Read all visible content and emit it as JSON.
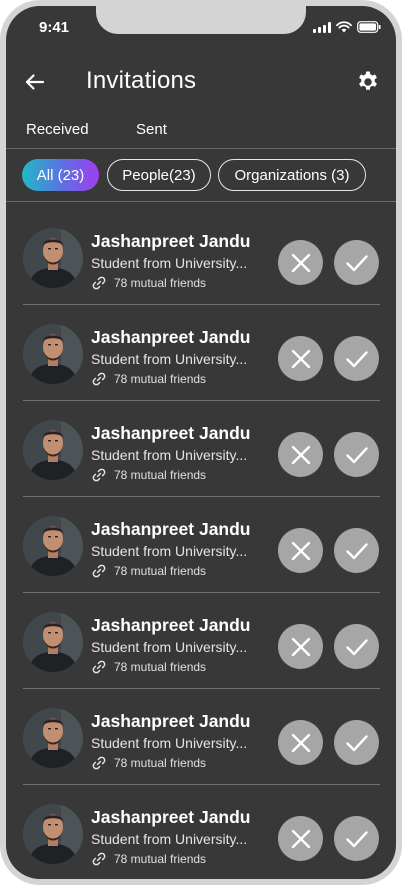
{
  "status_bar": {
    "time": "9:41"
  },
  "header": {
    "title": "Invitations"
  },
  "tabs": [
    {
      "label": "Received"
    },
    {
      "label": "Sent"
    }
  ],
  "filters": [
    {
      "label": "All (23)"
    },
    {
      "label": "People(23)"
    },
    {
      "label": "Organizations (3)"
    }
  ],
  "colors": {
    "background": "#383838",
    "chip_gradient_start": "#22b8c8",
    "chip_gradient_end": "#a03ef0",
    "action_button": "#a6a6a6"
  },
  "invitations": [
    {
      "name": "Jashanpreet Jandu",
      "subtitle": "Student from University...",
      "mutual": "78 mutual friends"
    },
    {
      "name": "Jashanpreet Jandu",
      "subtitle": "Student from University...",
      "mutual": "78 mutual friends"
    },
    {
      "name": "Jashanpreet Jandu",
      "subtitle": "Student from University...",
      "mutual": "78 mutual friends"
    },
    {
      "name": "Jashanpreet Jandu",
      "subtitle": "Student from University...",
      "mutual": "78 mutual friends"
    },
    {
      "name": "Jashanpreet Jandu",
      "subtitle": "Student from University...",
      "mutual": "78 mutual friends"
    },
    {
      "name": "Jashanpreet Jandu",
      "subtitle": "Student from University...",
      "mutual": "78 mutual friends"
    },
    {
      "name": "Jashanpreet Jandu",
      "subtitle": "Student from University...",
      "mutual": "78 mutual friends"
    }
  ]
}
